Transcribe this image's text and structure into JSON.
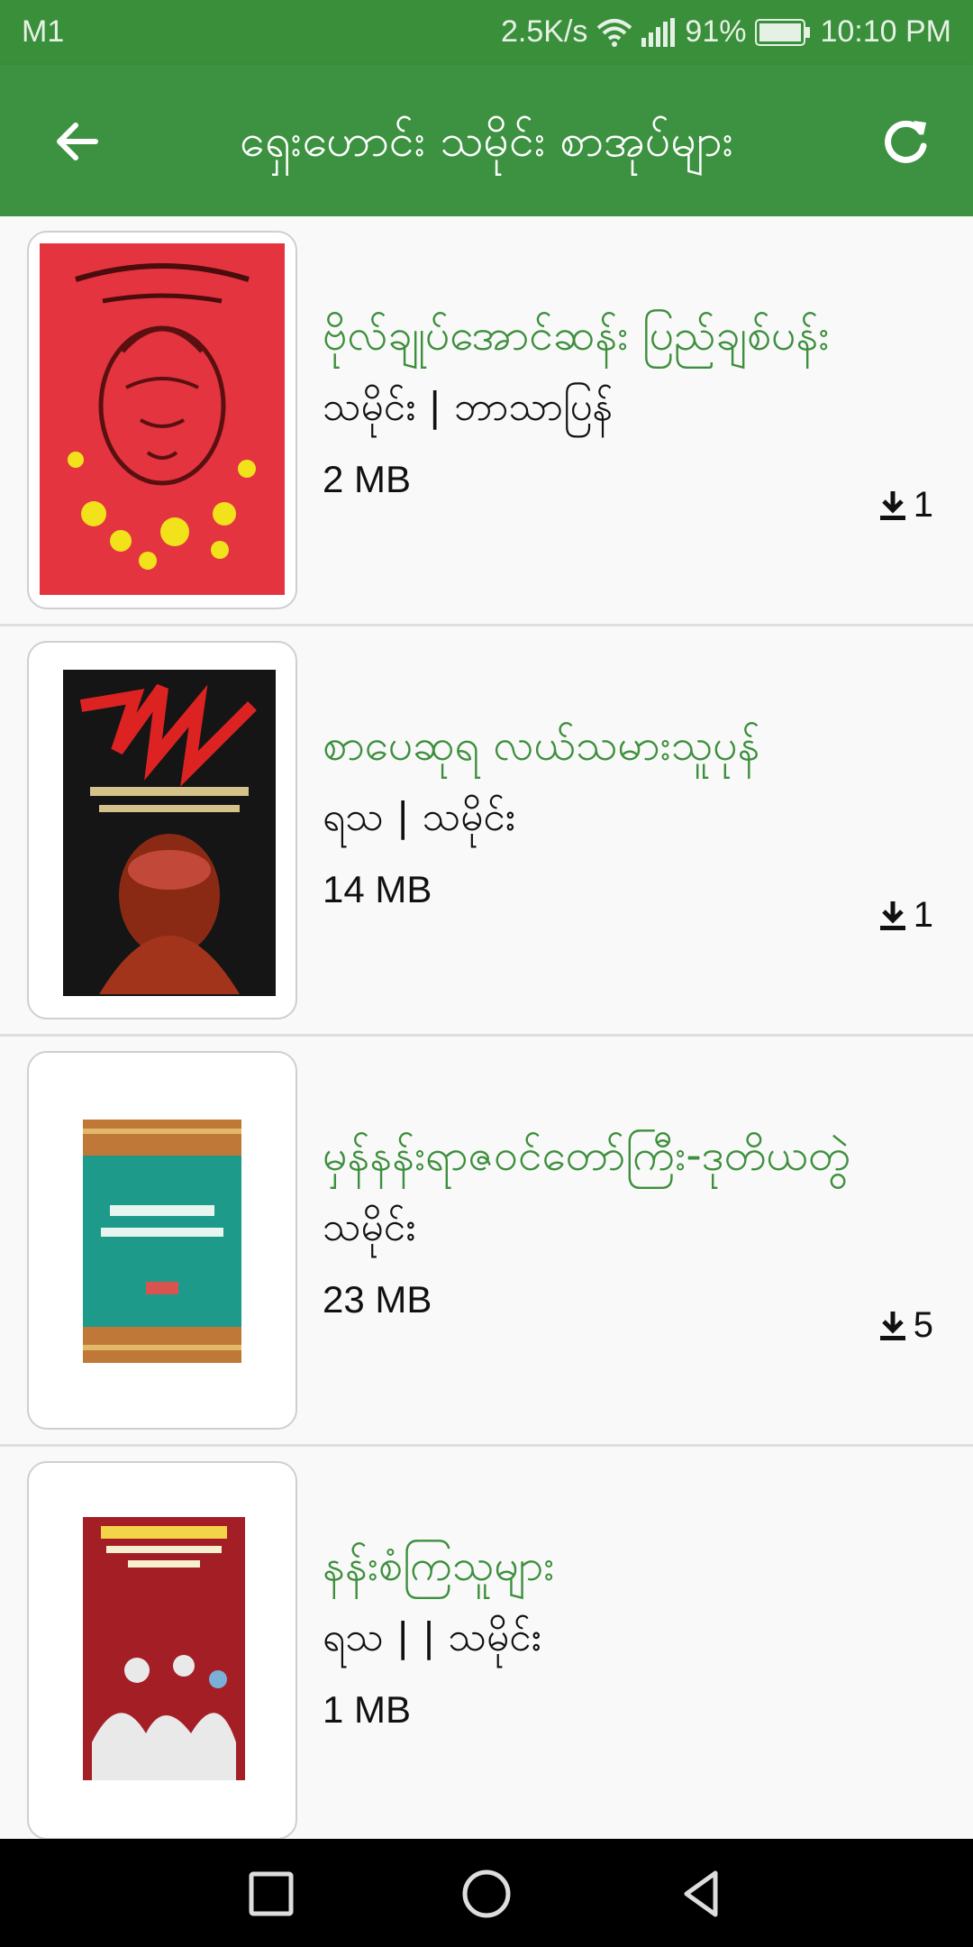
{
  "status_bar": {
    "carrier": "M1",
    "speed": "2.5K/s",
    "battery": "91%",
    "time": "10:10 PM"
  },
  "app_bar": {
    "title": "ရှေးဟောင်း သမိုင်း စာအုပ်များ"
  },
  "colors": {
    "primary": "#3c9240",
    "title_text": "#3d8f3d"
  },
  "books": [
    {
      "title": "ဗိုလ်ချုပ်အောင်ဆန်း ပြည်ချစ်ပန်း",
      "meta": "သမိုင်း | ဘာသာပြန်",
      "size": "2 MB",
      "downloads": "1"
    },
    {
      "title": "စာပေဆုရ လယ်သမားသူပုန်",
      "meta": "ရသ | သမိုင်း",
      "size": "14 MB",
      "downloads": "1"
    },
    {
      "title": "မှန်နန်းရာဇဝင်တော်ကြီး-ဒုတိယတွဲ",
      "meta": "သမိုင်း",
      "size": "23 MB",
      "downloads": "5"
    },
    {
      "title": "နန်းစံကြသူများ",
      "meta": "ရသ |   | သမိုင်း",
      "size": "1 MB",
      "downloads": ""
    }
  ]
}
